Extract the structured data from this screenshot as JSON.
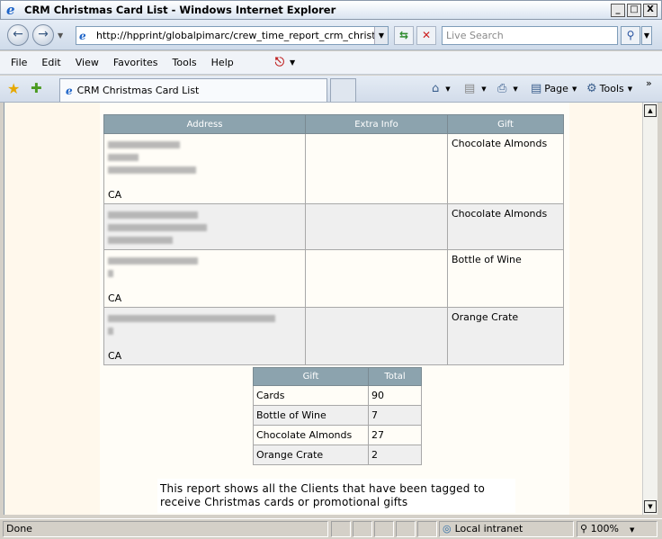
{
  "window": {
    "title": "CRM Christmas Card List - Windows Internet Explorer",
    "controls": [
      "_",
      "□",
      "X"
    ]
  },
  "address": {
    "url": "http://hpprint/globalpimarc/crew_time_report_crm_christmas.aspx",
    "search_placeholder": "Live Search"
  },
  "menu": [
    "File",
    "Edit",
    "View",
    "Favorites",
    "Tools",
    "Help"
  ],
  "tabs": {
    "active_label": "CRM Christmas Card List"
  },
  "commands": {
    "page_label": "Page",
    "tools_label": "Tools"
  },
  "report": {
    "headers": [
      "Address",
      "Extra Info",
      "Gift"
    ],
    "rows": [
      {
        "state": "CA",
        "extra": "",
        "gift": "Chocolate Almonds"
      },
      {
        "state": "",
        "extra": "",
        "gift": "Chocolate Almonds"
      },
      {
        "state": "CA",
        "extra": "",
        "gift": "Bottle of Wine"
      },
      {
        "state": "CA",
        "extra": "",
        "gift": "Orange Crate"
      }
    ]
  },
  "summary": {
    "headers": [
      "Gift",
      "Total"
    ],
    "rows": [
      {
        "gift": "Cards",
        "total": "90"
      },
      {
        "gift": "Bottle of Wine",
        "total": "7"
      },
      {
        "gift": "Chocolate Almonds",
        "total": "27"
      },
      {
        "gift": "Orange Crate",
        "total": "2"
      }
    ]
  },
  "note": "This report shows all the Clients that have been tagged to receive Christmas cards or promotional gifts",
  "status": {
    "text": "Done",
    "zone": "Local intranet",
    "zoom": "100%"
  }
}
